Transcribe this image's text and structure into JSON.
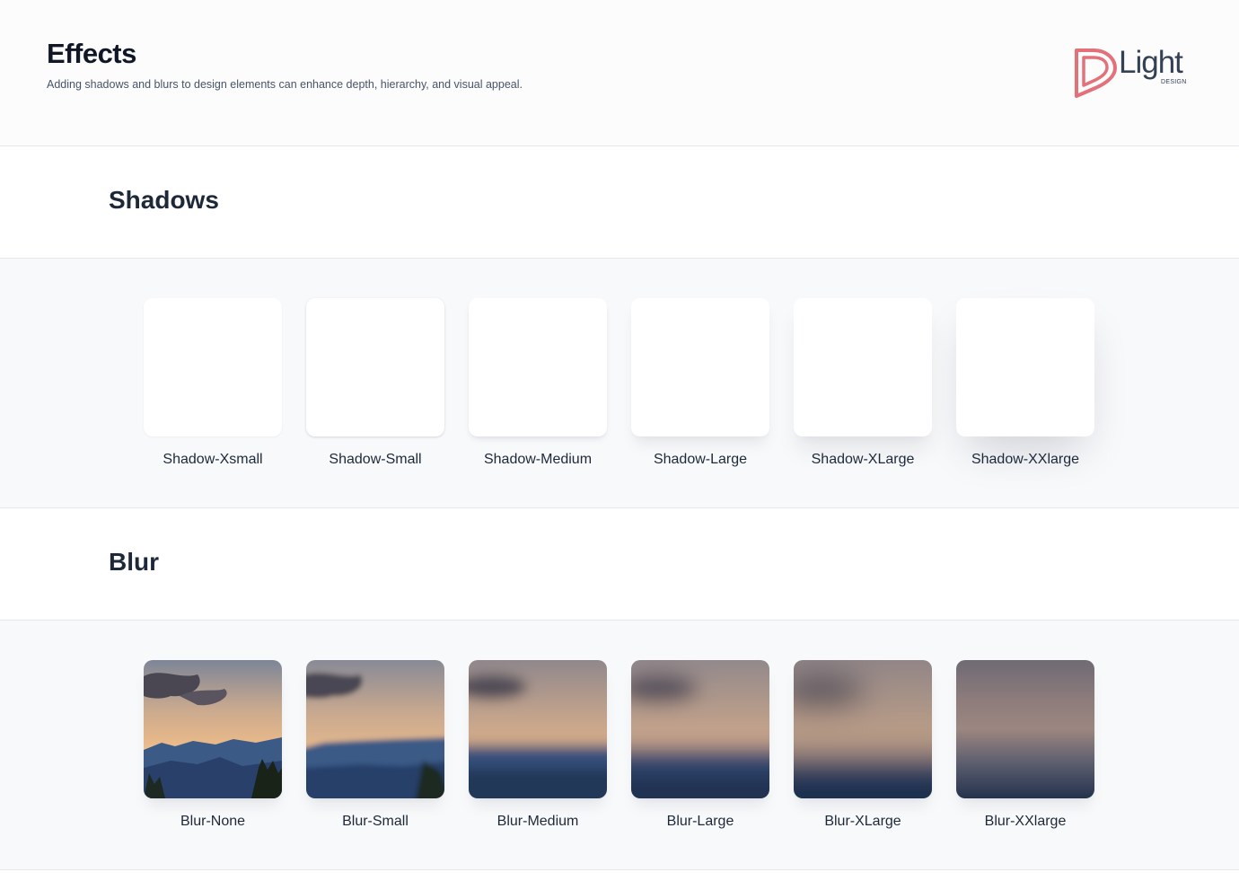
{
  "header": {
    "title": "Effects",
    "description": "Adding shadows and blurs to design elements can enhance depth, hierarchy, and visual appeal.",
    "logo": {
      "word": "Light",
      "sub": "DESIGN",
      "mark_color": "#e4717a"
    }
  },
  "shadows": {
    "title": "Shadows",
    "items": [
      {
        "label": "Shadow-Xsmall"
      },
      {
        "label": "Shadow-Small"
      },
      {
        "label": "Shadow-Medium"
      },
      {
        "label": "Shadow-Large"
      },
      {
        "label": "Shadow-XLarge"
      },
      {
        "label": "Shadow-XXlarge"
      }
    ]
  },
  "blur": {
    "title": "Blur",
    "items": [
      {
        "label": "Blur-None"
      },
      {
        "label": "Blur-Small"
      },
      {
        "label": "Blur-Medium"
      },
      {
        "label": "Blur-Large"
      },
      {
        "label": "Blur-XLarge"
      },
      {
        "label": "Blur-XXlarge"
      }
    ]
  },
  "colors": {
    "title": "#101828",
    "text_secondary": "#475467",
    "panel_bg": "#f8f9fb",
    "border": "#e4e7ec"
  }
}
